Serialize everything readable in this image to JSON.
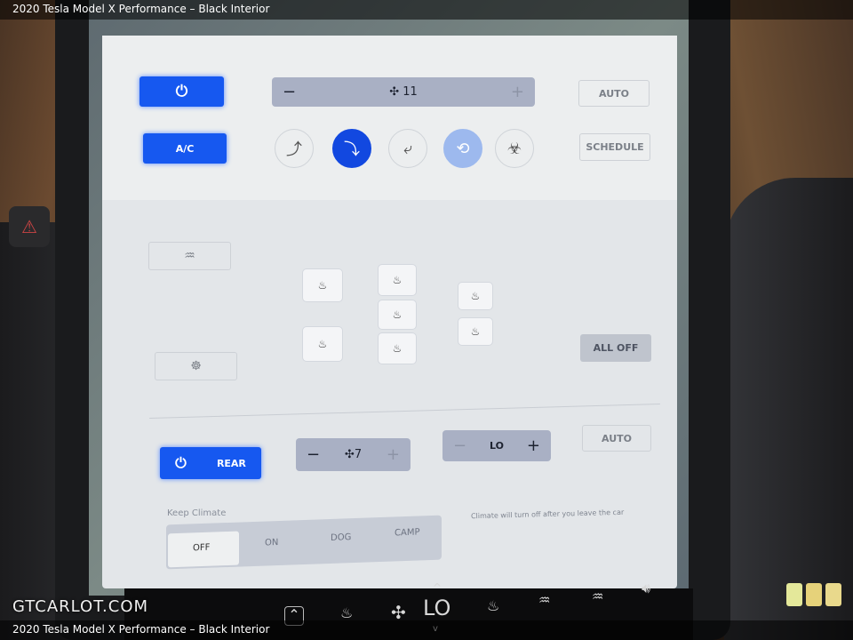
{
  "caption": "2020 Tesla Model X Performance – Black Interior",
  "watermark": "GTCARLOT.COM",
  "climate": {
    "power_icon": "power-icon",
    "ac_label": "A/C",
    "fan_minus": "−",
    "fan_level": "11",
    "fan_plus": "+",
    "auto_label": "AUTO",
    "schedule_label": "SCHEDULE",
    "airflow_modes": [
      {
        "icon": "airflow-face-icon",
        "active": false
      },
      {
        "icon": "airflow-feet-icon",
        "active": true
      },
      {
        "icon": "airflow-windshield-icon",
        "active": false
      },
      {
        "icon": "recirculate-icon",
        "active": true
      },
      {
        "icon": "bioweapon-defense-icon",
        "active": false
      }
    ],
    "rear_defrost_icon": "rear-defrost-icon",
    "steering_heat_icon": "steering-wheel-heat-icon",
    "all_off_label": "ALL OFF",
    "seat_heat_icon": "♨"
  },
  "rear": {
    "rear_label": "REAR",
    "fan_minus": "−",
    "fan_level": "7",
    "fan_plus": "+",
    "temp_minus": "−",
    "temp_value": "LO",
    "temp_plus": "+",
    "auto_label": "AUTO"
  },
  "keep_climate": {
    "label": "Keep Climate",
    "options": [
      "OFF",
      "ON",
      "DOG",
      "CAMP"
    ],
    "selected": "OFF",
    "note": "Climate will turn off after you leave the car"
  },
  "dock": {
    "temp": "LO",
    "up": "^",
    "down": "v"
  },
  "colors": {
    "accent": "#1658f0",
    "stepper": "#a9b0c4"
  }
}
